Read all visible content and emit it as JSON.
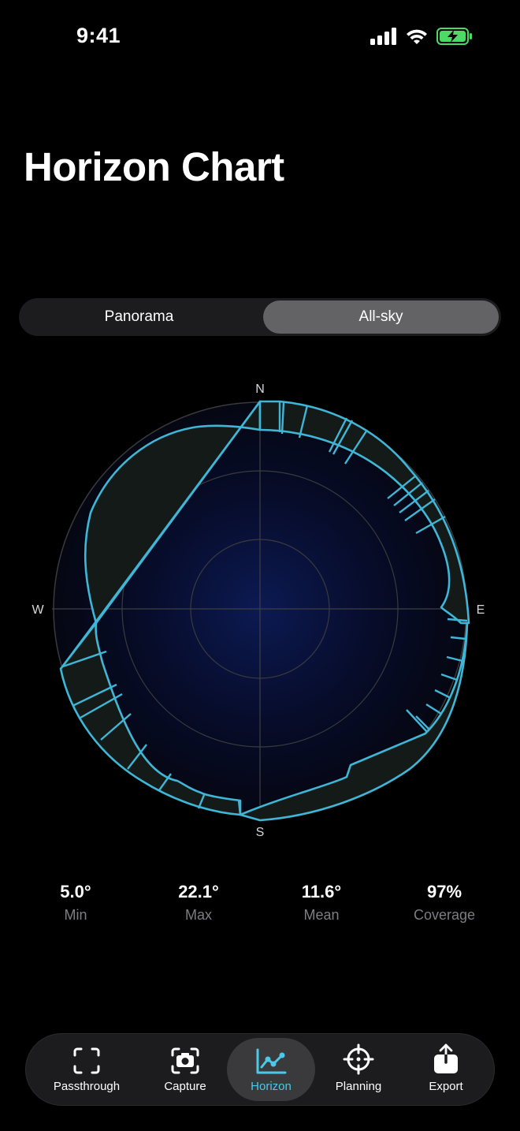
{
  "status_bar": {
    "time": "9:41"
  },
  "title": "Horizon Chart",
  "segments": {
    "left": "Panorama",
    "right": "All-sky",
    "selected": "All-sky"
  },
  "chart": {
    "n": "N",
    "e": "E",
    "s": "S",
    "w": "W",
    "accent": "#40b6d6"
  },
  "stats": [
    {
      "value": "5.0°",
      "label": "Min"
    },
    {
      "value": "22.1°",
      "label": "Max"
    },
    {
      "value": "11.6°",
      "label": "Mean"
    },
    {
      "value": "97%",
      "label": "Coverage"
    }
  ],
  "tabs": [
    {
      "label": "Passthrough",
      "icon": "viewfinder-icon"
    },
    {
      "label": "Capture",
      "icon": "camera-icon"
    },
    {
      "label": "Horizon",
      "icon": "chart-icon",
      "active": true
    },
    {
      "label": "Planning",
      "icon": "crosshair-icon"
    },
    {
      "label": "Export",
      "icon": "share-icon"
    }
  ]
}
